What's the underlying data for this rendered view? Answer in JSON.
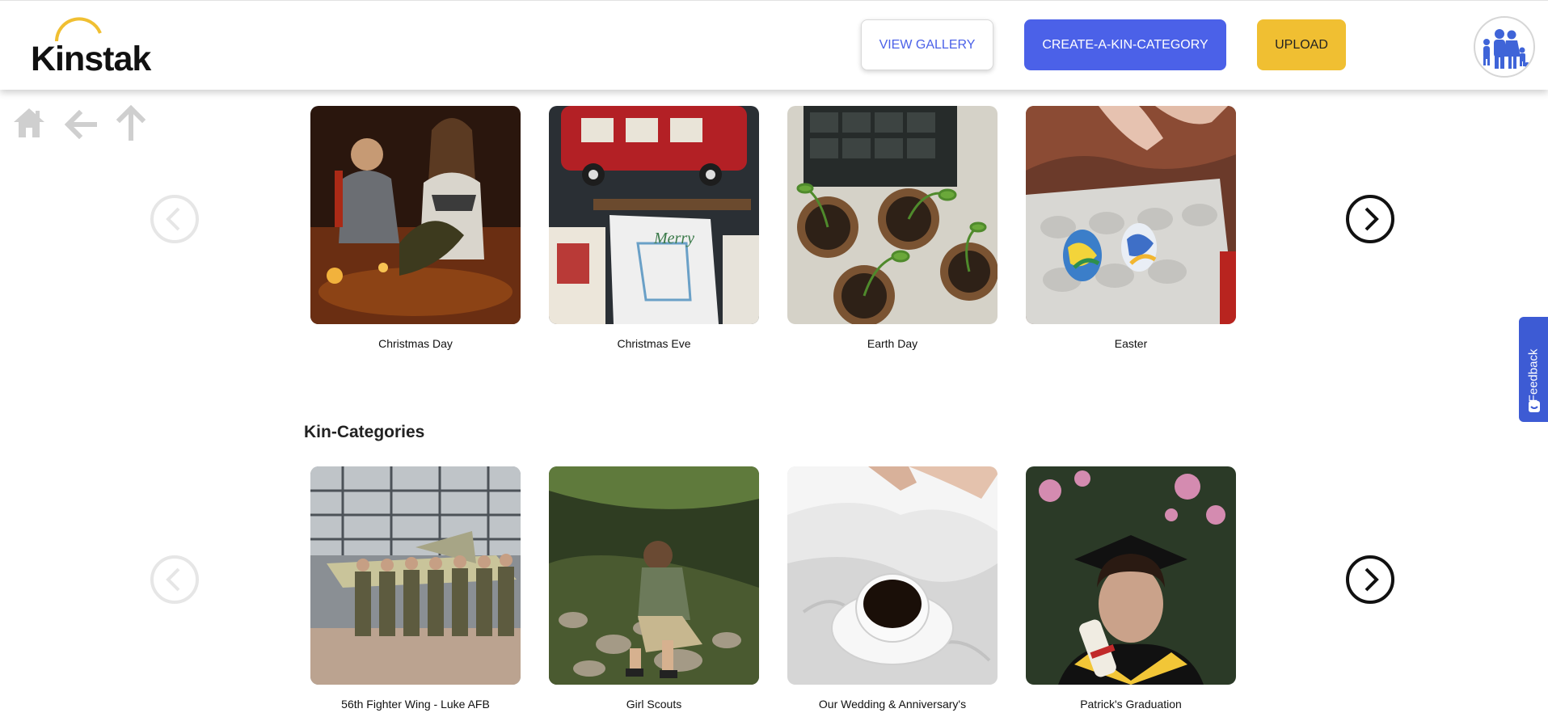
{
  "app": {
    "logo_text": "Kinstak"
  },
  "header": {
    "view_gallery": "VIEW GALLERY",
    "create_kin_category": "CREATE-A-KIN-CATEGORY",
    "upload": "UPLOAD"
  },
  "nav": {
    "icons": [
      "home-icon",
      "back-arrow-icon",
      "up-arrow-icon"
    ]
  },
  "holidays_row": {
    "items": [
      {
        "label": "Christmas Day"
      },
      {
        "label": "Christmas Eve"
      },
      {
        "label": "Earth Day"
      },
      {
        "label": "Easter"
      }
    ]
  },
  "kin_categories": {
    "title": "Kin-Categories",
    "items": [
      {
        "label": "56th Fighter Wing - Luke AFB"
      },
      {
        "label": "Girl Scouts"
      },
      {
        "label": "Our Wedding & Anniversary's"
      },
      {
        "label": "Patrick's Graduation"
      }
    ]
  },
  "feedback": {
    "label": "Feedback"
  },
  "colors": {
    "brand_blue": "#4b61e8",
    "brand_yellow": "#f0bf32",
    "feedback_blue": "#3d5bd4"
  }
}
